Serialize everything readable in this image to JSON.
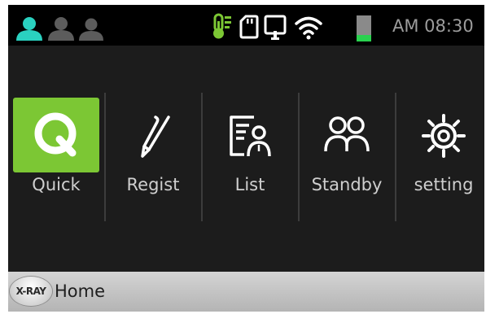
{
  "status_bar": {
    "users": [
      {
        "icon": "user-icon",
        "state": "active",
        "color": "#2ad1c0"
      },
      {
        "icon": "user-icon",
        "state": "inactive",
        "color": "#5c5c5c"
      },
      {
        "icon": "user-icon",
        "state": "inactive",
        "color": "#5c5c5c"
      }
    ],
    "icons": [
      {
        "name": "thermometer-icon",
        "color": "#7cc734"
      },
      {
        "name": "sd-card-icon",
        "color": "#ffffff"
      },
      {
        "name": "tablet-icon",
        "color": "#ffffff"
      },
      {
        "name": "wifi-icon",
        "color": "#ffffff"
      },
      {
        "name": "battery-icon",
        "color": "#2ad14f",
        "level": 0.2
      }
    ],
    "clock": "AM 08:30"
  },
  "menu": {
    "items": [
      {
        "label": "Quick",
        "icon": "quick-q-icon",
        "active": true
      },
      {
        "label": "Regist",
        "icon": "pen-icon",
        "active": false
      },
      {
        "label": "List",
        "icon": "patient-list-icon",
        "active": false
      },
      {
        "label": "Standby",
        "icon": "users-icon",
        "active": false
      },
      {
        "label": "setting",
        "icon": "gear-icon",
        "active": false
      }
    ],
    "quick_glyph": "Q"
  },
  "colors": {
    "accent": "#7cc734",
    "background": "#1c1c1c",
    "status_bar": "#000000"
  },
  "bottom_bar": {
    "badge": "X-RAY",
    "breadcrumb": "Home"
  }
}
